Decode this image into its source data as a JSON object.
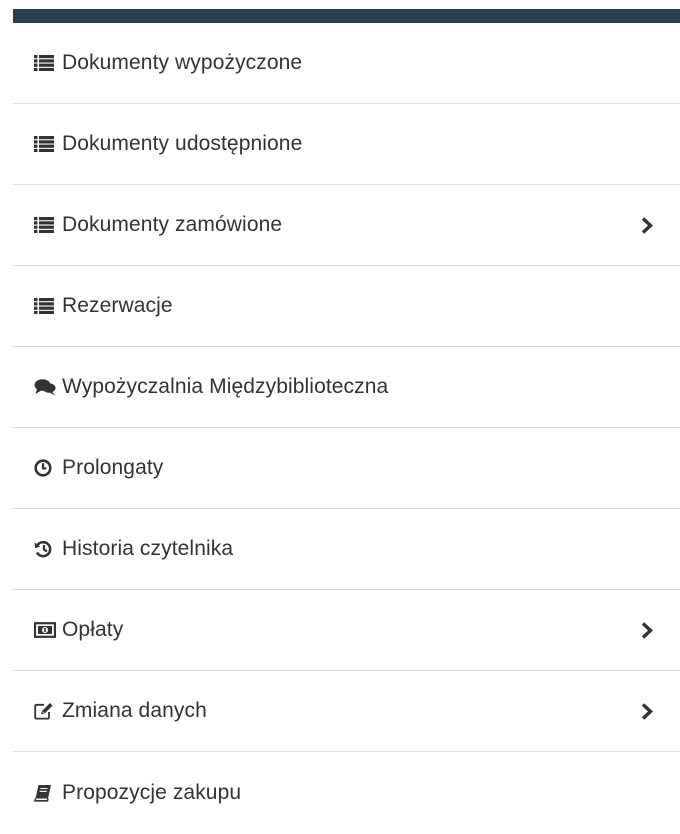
{
  "accent_color": "#2d3e55",
  "text_color": "#333333",
  "divider_color": "#dcdcdc",
  "menu": {
    "items": [
      {
        "label": "Dokumenty wypożyczone",
        "icon": "list-icon",
        "has_submenu": false
      },
      {
        "label": "Dokumenty udostępnione",
        "icon": "list-icon",
        "has_submenu": false
      },
      {
        "label": "Dokumenty zamówione",
        "icon": "list-icon",
        "has_submenu": true
      },
      {
        "label": "Rezerwacje",
        "icon": "list-icon",
        "has_submenu": false
      },
      {
        "label": "Wypożyczalnia Międzybiblioteczna",
        "icon": "comments-icon",
        "has_submenu": false
      },
      {
        "label": "Prolongaty",
        "icon": "clock-icon",
        "has_submenu": false
      },
      {
        "label": "Historia czytelnika",
        "icon": "history-icon",
        "has_submenu": false
      },
      {
        "label": "Opłaty",
        "icon": "money-icon",
        "has_submenu": true
      },
      {
        "label": "Zmiana danych",
        "icon": "edit-icon",
        "has_submenu": true
      },
      {
        "label": "Propozycje zakupu",
        "icon": "book-icon",
        "has_submenu": false
      }
    ]
  }
}
